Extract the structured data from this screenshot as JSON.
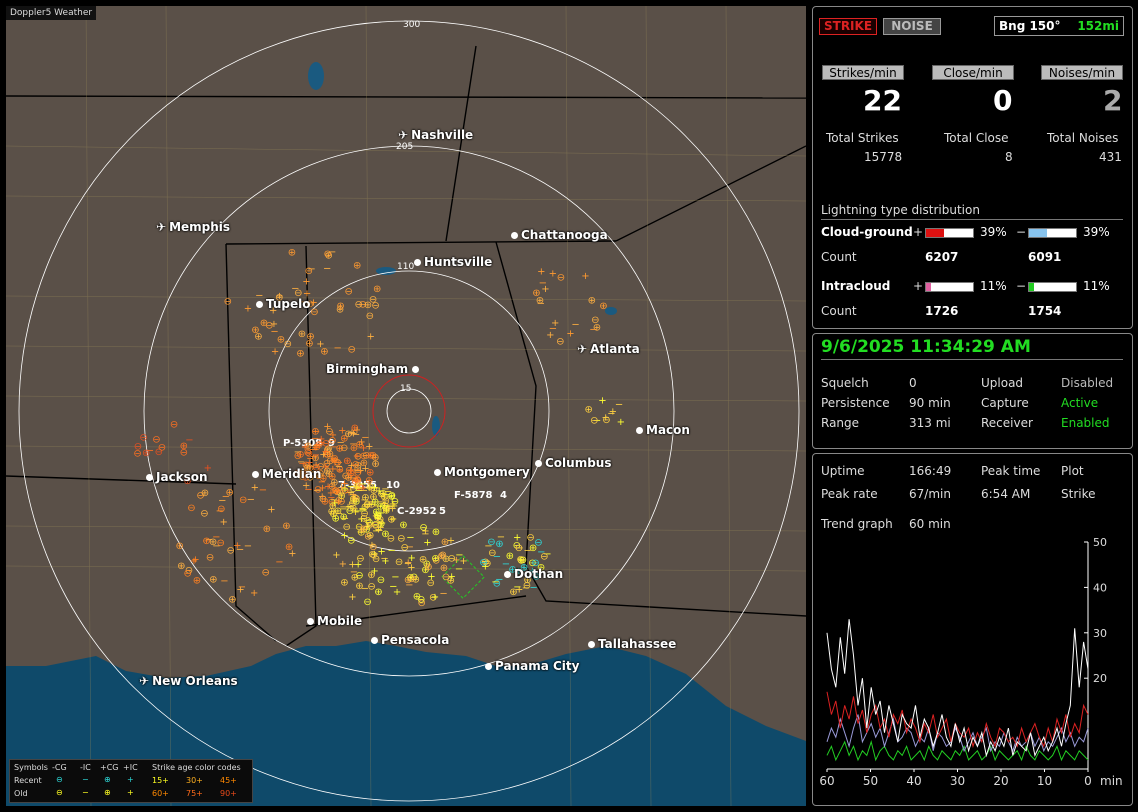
{
  "map": {
    "title": "Doppler5 Weather",
    "ring_labels": [
      "300",
      "205",
      "110",
      "15"
    ],
    "cities": [
      {
        "name": "Nashville",
        "type": "airport"
      },
      {
        "name": "Memphis",
        "type": "airport"
      },
      {
        "name": "Chattanooga",
        "type": "city"
      },
      {
        "name": "Huntsville",
        "type": "city"
      },
      {
        "name": "Tupelo",
        "type": "city"
      },
      {
        "name": "Atlanta",
        "type": "airport"
      },
      {
        "name": "Birmingham",
        "type": "city"
      },
      {
        "name": "Macon",
        "type": "city"
      },
      {
        "name": "Jackson",
        "type": "city"
      },
      {
        "name": "Meridian",
        "type": "city"
      },
      {
        "name": "Montgomery",
        "type": "city"
      },
      {
        "name": "Columbus",
        "type": "city"
      },
      {
        "name": "Dothan",
        "type": "city"
      },
      {
        "name": "Mobile",
        "type": "city"
      },
      {
        "name": "Pensacola",
        "type": "city"
      },
      {
        "name": "Tallahassee",
        "type": "city"
      },
      {
        "name": "Panama City",
        "type": "city"
      },
      {
        "name": "New Orleans",
        "type": "airport"
      }
    ],
    "storm_tags": [
      "P-5308",
      "9",
      "7-3055",
      "10",
      "F-5878",
      "4",
      "C-2952",
      "5"
    ],
    "legend": {
      "symbols_label": "Symbols",
      "cg_minus": "-CG",
      "ic_minus": "-IC",
      "cg_plus": "+CG",
      "ic_plus": "+IC",
      "age_label": "Strike age color codes",
      "recent": "Recent",
      "old": "Old",
      "ages": [
        "15+",
        "30+",
        "45+",
        "60+",
        "75+",
        "90+"
      ]
    }
  },
  "stats": {
    "strike_button": "STRIKE",
    "noise_button": "NOISE",
    "bearing_label": "Bng 150°",
    "bearing_distance": "152mi",
    "strikes_per_min_label": "Strikes/min",
    "close_per_min_label": "Close/min",
    "noises_per_min_label": "Noises/min",
    "strikes_per_min": "22",
    "close_per_min": "0",
    "noises_per_min": "2",
    "total_strikes_label": "Total Strikes",
    "total_close_label": "Total Close",
    "total_noises_label": "Total Noises",
    "total_strikes": "15778",
    "total_close": "8",
    "total_noises": "431",
    "dist_title": "Lightning type distribution",
    "cloud_ground_label": "Cloud-ground",
    "intracloud_label": "Intracloud",
    "count_label": "Count",
    "cg_pos_pct": "39%",
    "cg_neg_pct": "39%",
    "cg_pos_count": "6207",
    "cg_neg_count": "6091",
    "ic_pos_pct": "11%",
    "ic_neg_pct": "11%",
    "ic_pos_count": "1726",
    "ic_neg_count": "1754",
    "cg_pos_fraction": 0.39,
    "cg_neg_fraction": 0.39,
    "ic_pos_fraction": 0.11,
    "ic_neg_fraction": 0.11
  },
  "status": {
    "datetime": "9/6/2025 11:34:29 AM",
    "squelch_label": "Squelch",
    "squelch": "0",
    "persistence_label": "Persistence",
    "persistence": "90 min",
    "range_label": "Range",
    "range": "313 mi",
    "upload_label": "Upload",
    "upload": "Disabled",
    "capture_label": "Capture",
    "capture": "Active",
    "receiver_label": "Receiver",
    "receiver": "Enabled"
  },
  "trend": {
    "uptime_label": "Uptime",
    "uptime": "166:49",
    "peak_time_label": "Peak time",
    "peak_time": "6:54 AM",
    "plot_label": "Plot",
    "plot": "Strike",
    "peak_rate_label": "Peak rate",
    "peak_rate": "67/min",
    "trend_graph_label": "Trend graph",
    "trend_graph": "60 min"
  },
  "chart_data": {
    "type": "line",
    "x_unit": "min",
    "x_ticks": [
      "60",
      "50",
      "40",
      "30",
      "20",
      "10",
      "0"
    ],
    "y_ticks": [
      "50",
      "40",
      "30",
      "20"
    ],
    "xlim": [
      60,
      0
    ],
    "ylim": [
      0,
      50
    ],
    "series": [
      {
        "color": "#ffffff",
        "values": [
          30,
          22,
          18,
          29,
          21,
          33,
          25,
          14,
          20,
          9,
          18,
          12,
          15,
          8,
          14,
          10,
          6,
          12,
          10,
          9,
          14,
          7,
          11,
          9,
          5,
          8,
          12,
          7,
          5,
          10,
          6,
          9,
          4,
          7,
          5,
          8,
          3,
          6,
          4,
          7,
          5,
          9,
          3,
          6,
          5,
          4,
          8,
          3,
          5,
          7,
          4,
          6,
          9,
          5,
          10,
          14,
          31,
          18,
          28,
          22
        ]
      },
      {
        "color": "#dd2222",
        "values": [
          17,
          12,
          15,
          9,
          14,
          11,
          16,
          10,
          13,
          8,
          12,
          14,
          9,
          11,
          7,
          12,
          10,
          13,
          8,
          11,
          9,
          6,
          10,
          8,
          12,
          7,
          9,
          11,
          6,
          10,
          8,
          7,
          9,
          5,
          8,
          6,
          10,
          7,
          5,
          9,
          8,
          6,
          7,
          5,
          9,
          6,
          8,
          10,
          7,
          5,
          9,
          6,
          11,
          8,
          12,
          7,
          10,
          8,
          14,
          12
        ]
      },
      {
        "color": "#9a9ad8",
        "values": [
          6,
          9,
          7,
          11,
          8,
          5,
          9,
          12,
          6,
          8,
          10,
          7,
          9,
          5,
          8,
          11,
          6,
          7,
          9,
          8,
          5,
          7,
          6,
          9,
          4,
          8,
          7,
          5,
          6,
          9,
          7,
          4,
          6,
          8,
          5,
          7,
          9,
          4,
          6,
          5,
          8,
          6,
          4,
          7,
          5,
          6,
          8,
          5,
          7,
          4,
          6,
          5,
          7,
          9,
          6,
          8,
          5,
          7,
          6,
          9
        ]
      },
      {
        "color": "#22cc22",
        "values": [
          3,
          5,
          2,
          4,
          6,
          3,
          5,
          2,
          4,
          3,
          6,
          2,
          4,
          5,
          3,
          2,
          4,
          3,
          5,
          2,
          3,
          4,
          2,
          5,
          3,
          2,
          4,
          3,
          2,
          4,
          3,
          5,
          2,
          3,
          4,
          2,
          3,
          5,
          2,
          4,
          3,
          2,
          3,
          4,
          2,
          5,
          3,
          2,
          4,
          3,
          2,
          3,
          5,
          2,
          4,
          3,
          2,
          4,
          3,
          2
        ]
      }
    ]
  }
}
